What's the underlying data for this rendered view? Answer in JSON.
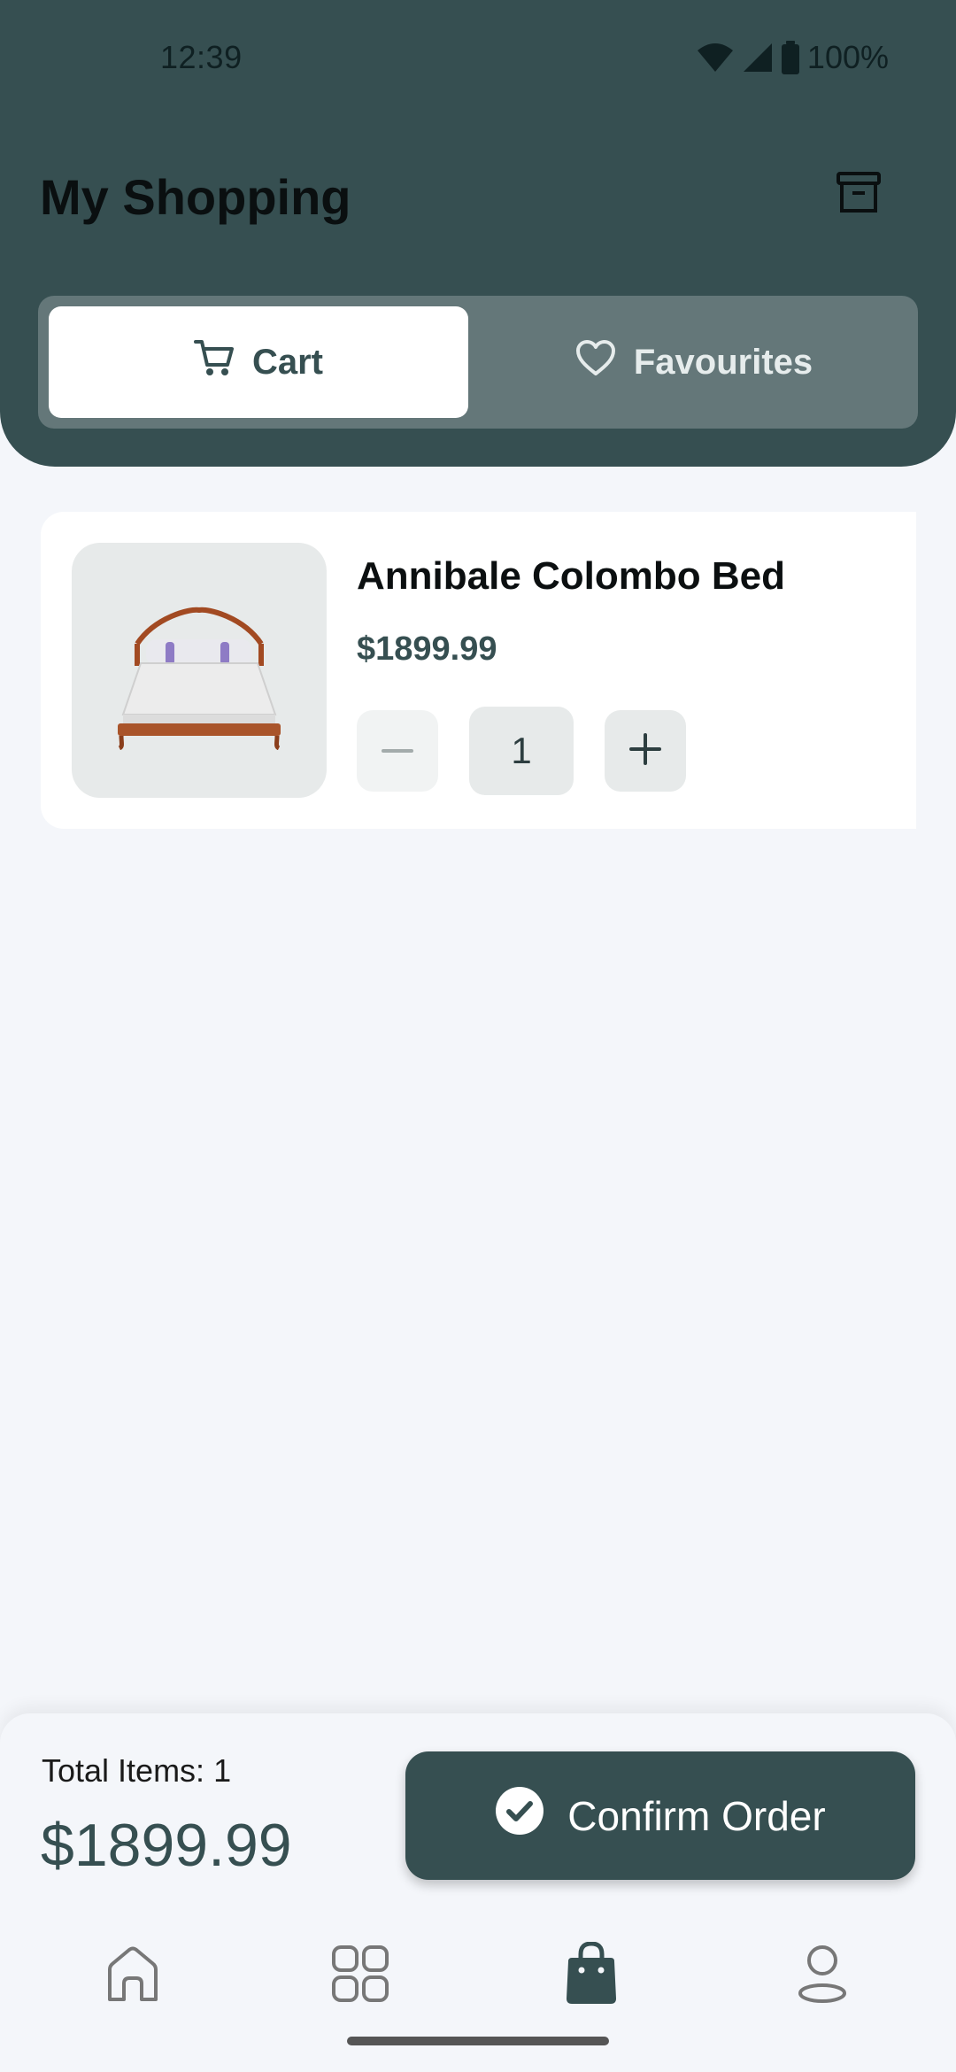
{
  "status_bar": {
    "time": "12:39",
    "battery": "100%"
  },
  "header": {
    "title": "My Shopping",
    "archive_icon": "archive-icon"
  },
  "tabs": [
    {
      "label": "Cart",
      "icon": "cart-icon",
      "active": true
    },
    {
      "label": "Favourites",
      "icon": "heart-icon",
      "active": false
    }
  ],
  "cart_items": [
    {
      "name": "Annibale Colombo Bed",
      "price": "$1899.99",
      "quantity": "1",
      "image": "bed-image"
    }
  ],
  "summary": {
    "total_items": "Total Items: 1",
    "total_price": "$1899.99",
    "confirm_label": "Confirm Order"
  },
  "bottom_nav": [
    {
      "name": "home",
      "icon": "home-icon",
      "active": false
    },
    {
      "name": "categories",
      "icon": "grid-icon",
      "active": false
    },
    {
      "name": "shopping",
      "icon": "shopping-bag-icon",
      "active": true
    },
    {
      "name": "profile",
      "icon": "profile-icon",
      "active": false
    }
  ],
  "colors": {
    "primary": "#364f51",
    "background": "#f4f6fa",
    "tab_bar": "#647779"
  }
}
